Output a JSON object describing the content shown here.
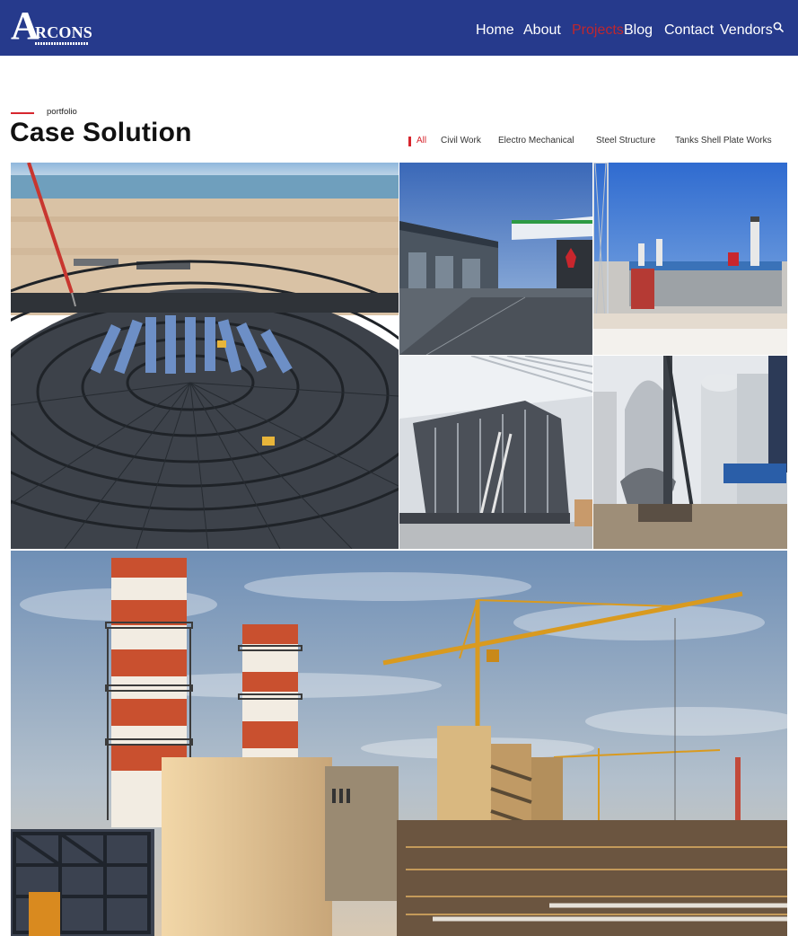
{
  "header": {
    "logo_initial": "A",
    "logo_rest": "RCONS",
    "nav": [
      {
        "label": "Home",
        "active": false
      },
      {
        "label": "About",
        "active": false
      },
      {
        "label": "Projects",
        "active": true
      },
      {
        "label": "Blog",
        "active": false
      },
      {
        "label": "Contact",
        "active": false
      },
      {
        "label": "Vendors",
        "active": false
      }
    ],
    "search_icon": "search-icon"
  },
  "section": {
    "eyebrow": "portfolio",
    "title": "Case Solution"
  },
  "filters": [
    {
      "label": "All",
      "active": true
    },
    {
      "label": "Civil Work",
      "active": false
    },
    {
      "label": "Electro Mechanical",
      "active": false
    },
    {
      "label": "Steel Structure",
      "active": false
    },
    {
      "label": "Tanks Shell Plate Works",
      "active": false
    }
  ],
  "colors": {
    "header_bg": "#263a8c",
    "accent": "#d7262e",
    "title": "#111111"
  }
}
